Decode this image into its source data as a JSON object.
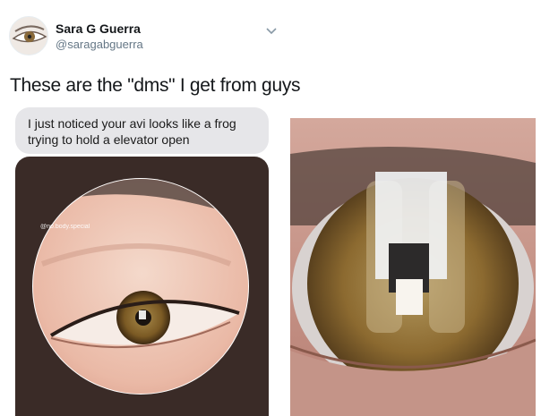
{
  "tweet": {
    "author_name": "Sara G Guerra",
    "author_handle": "@saragabguerra",
    "text": "These are the \"dms\" I get from guys"
  },
  "dm": {
    "message": "I just noticed your avi looks like a frog trying to hold a elevator open",
    "image_watermark": "@no.body.special"
  },
  "icons": [
    "avatar-eye-icon",
    "chevron-down-icon"
  ],
  "colors": {
    "dm_bubble": "#e6e6e9",
    "dm_image_bg": "#3a2b27",
    "handle_gray": "#657786"
  }
}
